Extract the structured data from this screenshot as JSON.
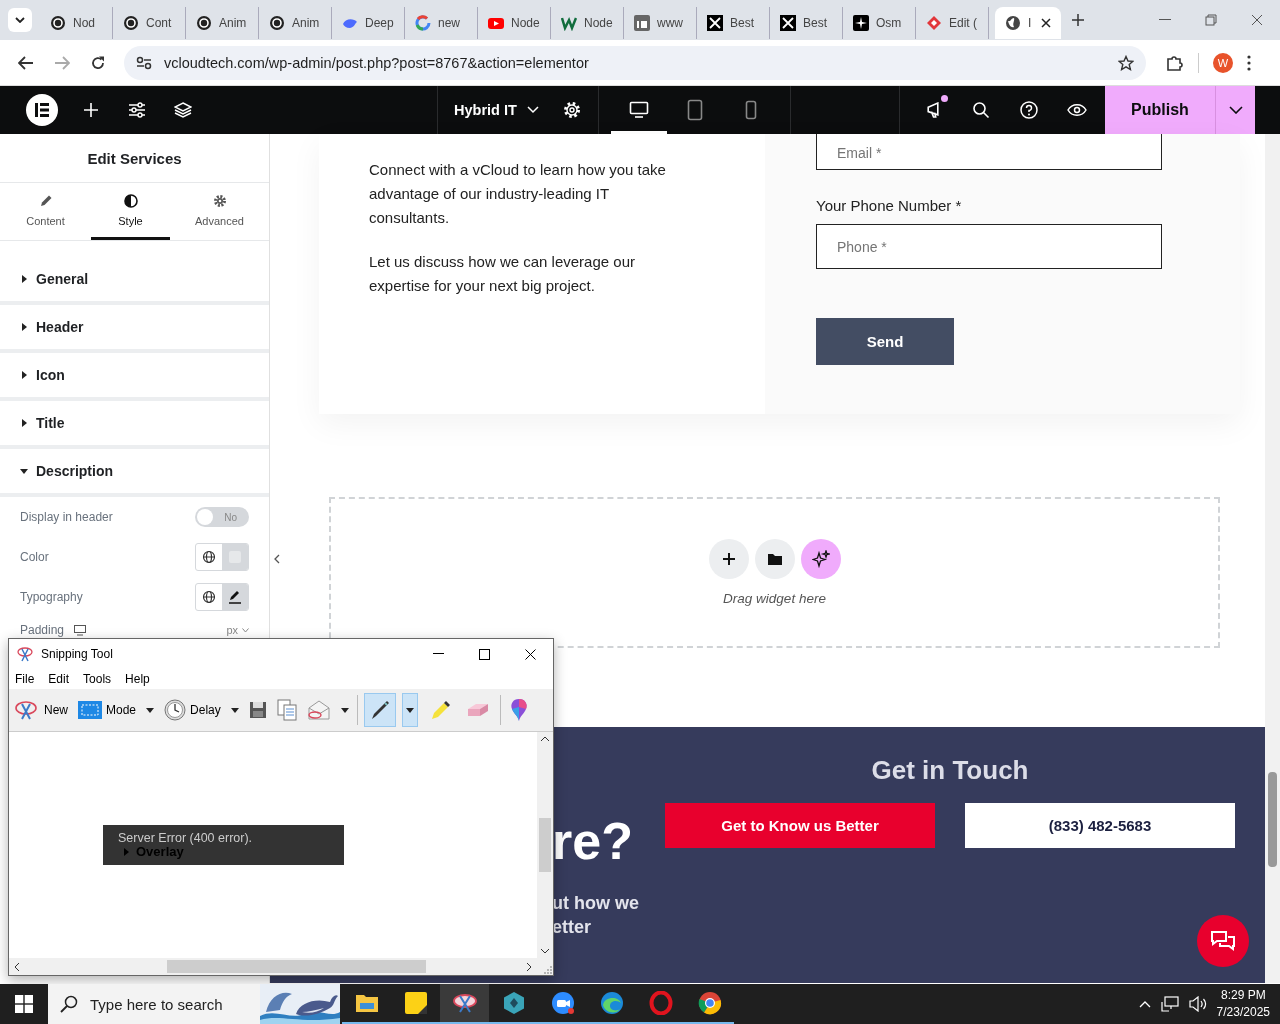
{
  "browser": {
    "tabs": [
      {
        "title": "Nod",
        "kind": "knot",
        "selected": false
      },
      {
        "title": "Cont",
        "kind": "knot",
        "selected": false
      },
      {
        "title": "Anim",
        "kind": "knot",
        "selected": false
      },
      {
        "title": "Anim",
        "kind": "knot",
        "selected": false
      },
      {
        "title": "Deep",
        "kind": "whale",
        "selected": false
      },
      {
        "title": "new",
        "kind": "ring",
        "selected": false
      },
      {
        "title": "Node",
        "kind": "play",
        "selected": false
      },
      {
        "title": "Node",
        "kind": "zigzag",
        "selected": false
      },
      {
        "title": "www",
        "kind": "tile",
        "selected": false
      },
      {
        "title": "Best",
        "kind": "cross",
        "selected": false
      },
      {
        "title": "Best",
        "kind": "cross",
        "selected": false
      },
      {
        "title": "Osm",
        "kind": "sparkle",
        "selected": false
      },
      {
        "title": "Edit (",
        "kind": "diamond",
        "selected": false
      },
      {
        "title": "I",
        "kind": "globe",
        "selected": true
      }
    ],
    "url": "vcloudtech.com/wp-admin/post.php?post=8767&action=elementor",
    "profile": "W"
  },
  "editor_bar": {
    "page_title": "Hybrid IT",
    "publish": "Publish",
    "devices": [
      {
        "kind": "desktop",
        "selected": true
      },
      {
        "kind": "tablet",
        "selected": false
      },
      {
        "kind": "mobile",
        "selected": false
      }
    ]
  },
  "panel": {
    "title": "Edit Services",
    "tabs": [
      {
        "label": "Content",
        "kind": "pencil",
        "selected": false
      },
      {
        "label": "Style",
        "kind": "contrast",
        "selected": true
      },
      {
        "label": "Advanced",
        "kind": "gear",
        "selected": false
      }
    ],
    "sections": [
      {
        "label": "General",
        "expanded": false
      },
      {
        "label": "Header",
        "expanded": false
      },
      {
        "label": "Icon",
        "expanded": false
      },
      {
        "label": "Title",
        "expanded": false
      },
      {
        "label": "Description",
        "expanded": true
      }
    ],
    "controls": [
      {
        "kind": "toggle",
        "label": "Display in header",
        "on": false,
        "value": "No"
      },
      {
        "kind": "color",
        "label": "Color"
      },
      {
        "kind": "typography",
        "label": "Typography"
      },
      {
        "kind": "dimension",
        "label": "Padding",
        "unit": "px"
      }
    ]
  },
  "canvas": {
    "paragraphs": [
      "Connect with a vCloud to learn how you take advantage of our industry-leading IT consultants.",
      "Let us discuss how we can leverage our expertise for your next big project."
    ],
    "form": {
      "email_placeholder": "Email *",
      "phone_label": "Your Phone Number *",
      "phone_placeholder": "Phone *",
      "submit": "Send"
    },
    "dropzone": {
      "hint": "Drag widget here"
    },
    "cta": {
      "title": "Get in Touch",
      "heading_fragment": "re?",
      "text_lines": [
        "ut how we",
        "etter"
      ],
      "buttons": [
        {
          "label": "Get to Know us Better",
          "kind": "primary"
        },
        {
          "label": "(833) 482-5683",
          "kind": "secondary"
        }
      ]
    }
  },
  "snipping_tool": {
    "title": "Snipping Tool",
    "menu": [
      "File",
      "Edit",
      "Tools",
      "Help"
    ],
    "toolbar": [
      {
        "kind": "new",
        "label": "New"
      },
      {
        "kind": "mode",
        "label": "Mode"
      },
      {
        "kind": "delay",
        "label": "Delay"
      }
    ],
    "tools": [
      {
        "kind": "pen",
        "selected": true
      },
      {
        "kind": "highlighter",
        "selected": false
      },
      {
        "kind": "eraser",
        "selected": false
      }
    ],
    "error_text": "Server Error (400 error).",
    "overlay_label": "Overlay"
  },
  "taskbar": {
    "search_placeholder": "Type here to search",
    "time": "8:29 PM",
    "date": "7/23/2025"
  }
}
